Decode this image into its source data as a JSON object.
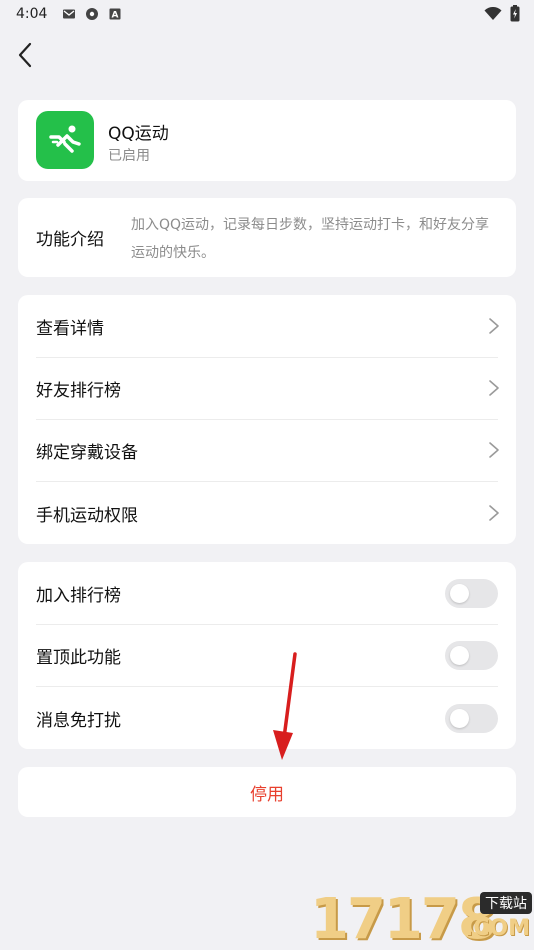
{
  "status_bar": {
    "time": "4:04",
    "icons": [
      "mail-icon",
      "settings-app-icon",
      "a-badge-icon",
      "wifi-icon",
      "battery-icon"
    ]
  },
  "app": {
    "name": "QQ运动",
    "status": "已启用",
    "icon": "running-person-icon",
    "icon_color": "#24c04a"
  },
  "intro": {
    "label": "功能介绍",
    "text": "加入QQ运动，记录每日步数，坚持运动打卡，和好友分享运动的快乐。"
  },
  "nav_items": [
    {
      "label": "查看详情"
    },
    {
      "label": "好友排行榜"
    },
    {
      "label": "绑定穿戴设备"
    },
    {
      "label": "手机运动权限"
    }
  ],
  "toggle_items": [
    {
      "label": "加入排行榜",
      "on": false
    },
    {
      "label": "置顶此功能",
      "on": false
    },
    {
      "label": "消息免打扰",
      "on": false
    }
  ],
  "stop_button": {
    "label": "停用",
    "color": "#e8402e"
  },
  "watermark": {
    "digits": "17178",
    "badge": "下载站",
    "domain": ".COM"
  }
}
